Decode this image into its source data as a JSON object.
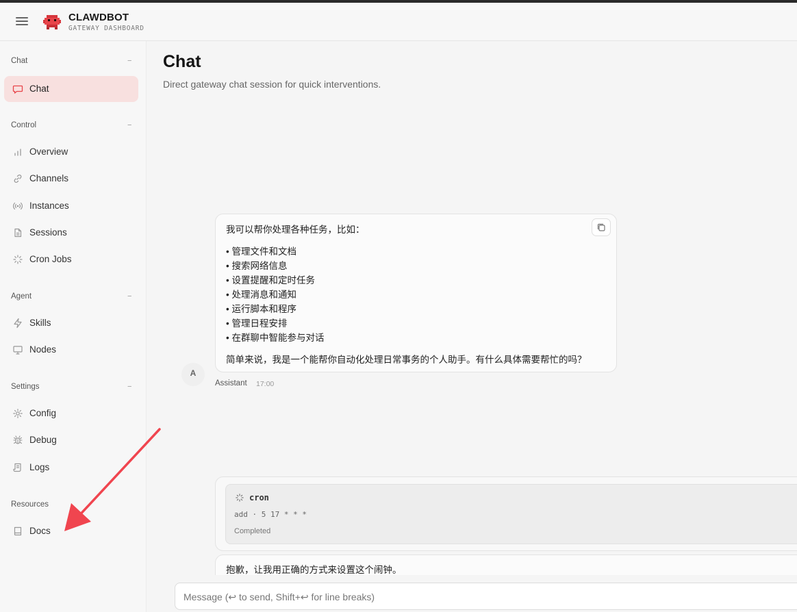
{
  "header": {
    "brand_title": "CLAWDBOT",
    "brand_subtitle": "GATEWAY DASHBOARD"
  },
  "sidebar": {
    "groups": [
      {
        "label": "Chat",
        "collapse": "−",
        "items": [
          {
            "label": "Chat",
            "icon": "message-square-icon",
            "active": true
          }
        ]
      },
      {
        "label": "Control",
        "collapse": "−",
        "items": [
          {
            "label": "Overview",
            "icon": "bar-chart-icon"
          },
          {
            "label": "Channels",
            "icon": "link-icon"
          },
          {
            "label": "Instances",
            "icon": "radio-icon"
          },
          {
            "label": "Sessions",
            "icon": "file-text-icon"
          },
          {
            "label": "Cron Jobs",
            "icon": "loader-icon"
          }
        ]
      },
      {
        "label": "Agent",
        "collapse": "−",
        "items": [
          {
            "label": "Skills",
            "icon": "zap-icon"
          },
          {
            "label": "Nodes",
            "icon": "monitor-icon"
          }
        ]
      },
      {
        "label": "Settings",
        "collapse": "−",
        "items": [
          {
            "label": "Config",
            "icon": "gear-icon"
          },
          {
            "label": "Debug",
            "icon": "bug-icon"
          },
          {
            "label": "Logs",
            "icon": "scroll-icon"
          }
        ]
      },
      {
        "label": "Resources",
        "items": [
          {
            "label": "Docs",
            "icon": "book-icon"
          }
        ]
      }
    ]
  },
  "main": {
    "title": "Chat",
    "subtitle": "Direct gateway chat session for quick interventions.",
    "messages": [
      {
        "intro": "我可以帮你处理各种任务，比如：",
        "bullets": [
          "• 管理文件和文档",
          "• 搜索网络信息",
          "• 设置提醒和定时任务",
          "• 处理消息和通知",
          "• 运行脚本和程序",
          "• 管理日程安排",
          "• 在群聊中智能参与对话"
        ],
        "outro": "简单来说，我是一个能帮你自动化处理日常事务的个人助手。有什么具体需要帮忙的吗？",
        "avatar": "A",
        "sender": "Assistant",
        "time": "17:00"
      }
    ],
    "tool_call": {
      "name": "cron",
      "args": "add · 5 17 * * *",
      "status": "Completed"
    },
    "next_message": "抱歉，让我用正确的方式来设置这个闹钟。"
  },
  "composer": {
    "placeholder": "Message (↩ to send, Shift+↩ for line breaks)"
  },
  "colors": {
    "accent": "#e8454a",
    "active_bg": "#f8e0df",
    "annotation_arrow": "#f0454f"
  }
}
